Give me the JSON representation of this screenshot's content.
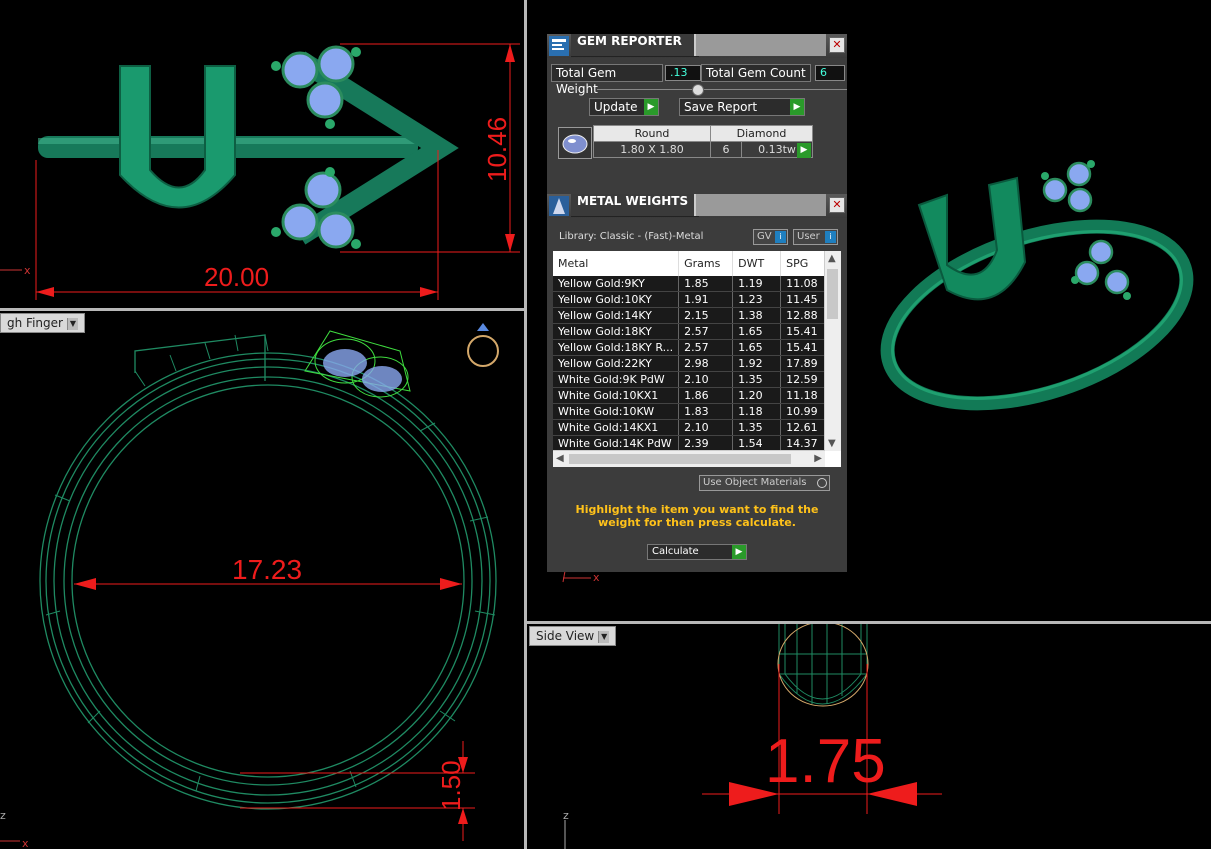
{
  "viewports": {
    "top_left": {
      "dims": {
        "width": "20.00",
        "height": "10.46"
      },
      "axis_label": "x"
    },
    "bottom_left": {
      "view_label": "gh Finger",
      "dims": {
        "diameter": "17.23",
        "thickness": "1.50"
      },
      "axis_label": "x",
      "axis_label_z": "z"
    },
    "right_top": {
      "axis_label": "x"
    },
    "bottom_right": {
      "view_label": "Side View",
      "dims": {
        "width": "1.75"
      },
      "axis_label": "z"
    }
  },
  "gem_reporter": {
    "title": "GEM REPORTER",
    "close": "✕",
    "total_gem_weight_label": "Total Gem Weight",
    "total_gem_weight_value": ".13",
    "total_gem_count_label": "Total Gem Count",
    "total_gem_count_value": "6",
    "update_label": "Update",
    "save_report_label": "Save Report",
    "gem_table": {
      "header": [
        "Round",
        "Diamond"
      ],
      "row": {
        "size": "1.80 X 1.80",
        "count": "6",
        "weight": "0.13tw"
      }
    }
  },
  "metal_weights": {
    "title": "METAL WEIGHTS",
    "close": "✕",
    "library": "Library: Classic - (Fast)-Metal",
    "gv_label": "GV",
    "user_label": "User",
    "columns": [
      "Metal",
      "Grams",
      "DWT",
      "SPG"
    ],
    "rows": [
      [
        "Yellow Gold:9KY",
        "1.85",
        "1.19",
        "11.08"
      ],
      [
        "Yellow Gold:10KY",
        "1.91",
        "1.23",
        "11.45"
      ],
      [
        "Yellow Gold:14KY",
        "2.15",
        "1.38",
        "12.88"
      ],
      [
        "Yellow Gold:18KY",
        "2.57",
        "1.65",
        "15.41"
      ],
      [
        "Yellow Gold:18KY R...",
        "2.57",
        "1.65",
        "15.41"
      ],
      [
        "Yellow Gold:22KY",
        "2.98",
        "1.92",
        "17.89"
      ],
      [
        "White Gold:9K PdW",
        "2.10",
        "1.35",
        "12.59"
      ],
      [
        "White Gold:10KX1",
        "1.86",
        "1.20",
        "11.18"
      ],
      [
        "White Gold:10KW",
        "1.83",
        "1.18",
        "10.99"
      ],
      [
        "White Gold:14KX1",
        "2.10",
        "1.35",
        "12.61"
      ],
      [
        "White Gold:14K PdW",
        "2.39",
        "1.54",
        "14.37"
      ]
    ],
    "use_object_materials_label": "Use Object Materials",
    "hint": "Highlight the item you want to find the weight for then press calculate.",
    "calculate_label": "Calculate"
  },
  "colors": {
    "ring_green": "#0f7a55",
    "dimension_red": "#ee1c1c",
    "gem_blue": "#8aa8f0",
    "hint_yellow": "#ffc21a"
  }
}
